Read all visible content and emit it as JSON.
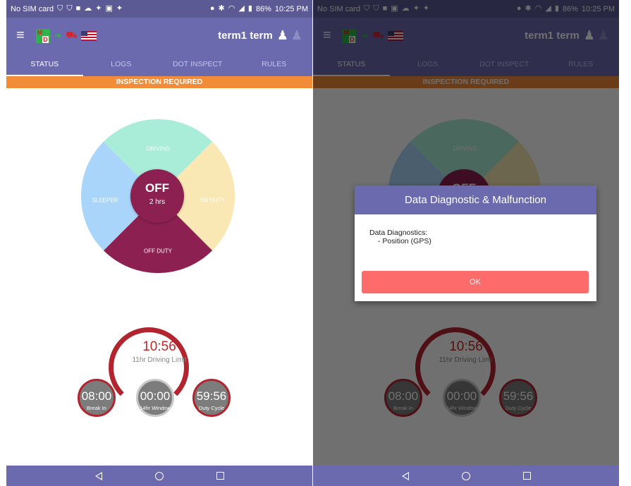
{
  "status_bar": {
    "left_text": "No SIM card",
    "battery": "86%",
    "time": "10:25 PM"
  },
  "app_bar": {
    "menu_icon": "hamburger-icon",
    "logo_letters": [
      "M",
      "D"
    ],
    "user_name": "term1 term"
  },
  "tabs": [
    "STATUS",
    "LOGS",
    "DOT INSPECT",
    "RULES"
  ],
  "active_tab": "STATUS",
  "banner": "INSPECTION REQUIRED",
  "wheel": {
    "segments": [
      {
        "label": "DRIVING",
        "color": "#a9ecd7"
      },
      {
        "label": "ON DUTY",
        "color": "#f9e8b3"
      },
      {
        "label": "OFF DUTY",
        "color": "#8c2151"
      },
      {
        "label": "SLEEPER",
        "color": "#a9d5fa"
      }
    ],
    "current_status": "OFF",
    "current_duration": "2 hrs"
  },
  "driving": {
    "time": "10:56",
    "label": "11hr Driving Limit"
  },
  "clocks": [
    {
      "value": "08:00",
      "label": "Break In"
    },
    {
      "value": "00:00",
      "label": "14hr Window"
    },
    {
      "value": "59:56",
      "label": "Duty Cycle"
    }
  ],
  "dialog": {
    "title": "Data Diagnostic & Malfunction",
    "heading": "Data Diagnostics:",
    "item": "- Position (GPS)",
    "button": "OK"
  },
  "colors": {
    "primary": "#6c6aaf",
    "banner": "#f28c38",
    "accent_red": "#b2252f",
    "ok_button": "#fd6b6b"
  }
}
